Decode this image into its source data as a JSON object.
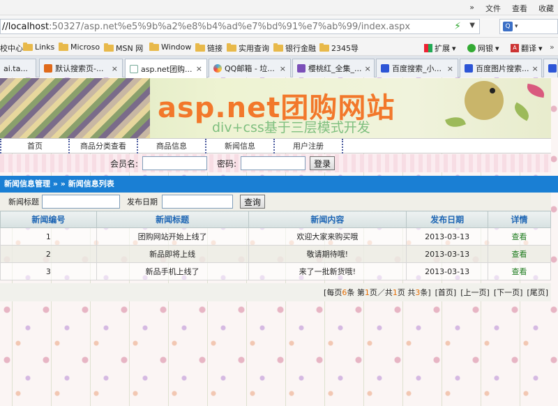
{
  "browser": {
    "menu": [
      "文件",
      "查看",
      "收藏"
    ],
    "menu_more": "»",
    "url_host": "//localhost",
    "url_path": ":50327/asp.net%e5%9b%a2%e8%b4%ad%e7%bd%91%e7%ab%99/index.aspx",
    "bookmarks": [
      "校中心",
      "Links",
      "Microso",
      "MSN 网",
      "Window",
      "链接",
      "实用查询",
      "银行金融",
      "2345导"
    ],
    "toolbar_right": [
      "扩展",
      "网银",
      "翻译"
    ],
    "tabs": [
      {
        "label": "ai.ta...",
        "active": false
      },
      {
        "label": "默认搜索页-...",
        "active": false
      },
      {
        "label": "asp.net团购...",
        "active": true
      },
      {
        "label": "QQ邮箱 - 垃...",
        "active": false
      },
      {
        "label": "樱桃红_全集_...",
        "active": false
      },
      {
        "label": "百度搜索_小...",
        "active": false
      },
      {
        "label": "百度图片搜索...",
        "active": false
      }
    ],
    "tab_close": "×"
  },
  "banner": {
    "title": "asp.net团购网站",
    "subtitle": "div+css基于三层模式开发"
  },
  "nav": [
    "首页",
    "商品分类查看",
    "商品信息",
    "新闻信息",
    "用户注册"
  ],
  "login": {
    "user_label": "会员名:",
    "pass_label": "密码:",
    "button": "登录"
  },
  "breadcrumb": "新闻信息管理 » » 新闻信息列表",
  "filter": {
    "title_label": "新闻标题",
    "date_label": "发布日期",
    "button": "查询"
  },
  "table": {
    "headers": [
      "新闻编号",
      "新闻标题",
      "新闻内容",
      "发布日期",
      "详情"
    ],
    "rows": [
      [
        "1",
        "团购网站开始上线了",
        "欢迎大家来购买哦",
        "2013-03-13",
        "查看"
      ],
      [
        "2",
        "新品即将上线",
        "敬请期待哦!",
        "2013-03-13",
        "查看"
      ],
      [
        "3",
        "新品手机上线了",
        "来了一批新货哦!",
        "2013-03-13",
        "查看"
      ]
    ]
  },
  "pager": {
    "per_page_pre": "[每页",
    "per_page": "6",
    "per_page_post": "条 第",
    "cur": "1",
    "mid": "页／共",
    "total_pages": "1",
    "total_pre": "页 共",
    "total": "3",
    "total_post": "条]",
    "first": "[首页]",
    "prev": "[上一页]",
    "next": "[下一页]",
    "last": "[尾页]"
  },
  "colors": {
    "accent": "#1a7fd4",
    "banner_title": "#f2782b",
    "header_text": "#1e66b4",
    "link": "#1c7a1c"
  }
}
